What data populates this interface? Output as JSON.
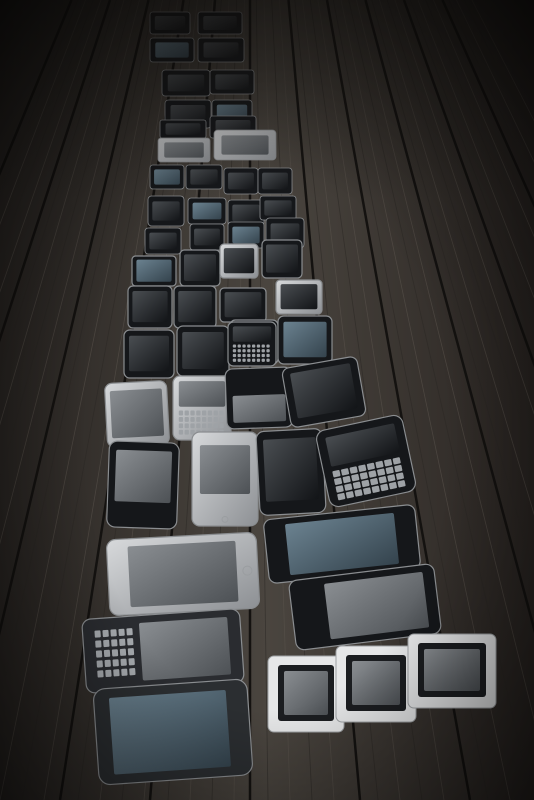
{
  "image": {
    "kind": "photograph",
    "palette": {
      "wood_dark": "#1c1916",
      "wood_mid": "#3e3a35",
      "wood_light": "#6b655c",
      "phone_body": "#15171a",
      "phone_silver": "#b9bcbf",
      "screen_grey": "#6f7377",
      "screen_blue": "#4f6574",
      "vignette": "#000000"
    },
    "phones": [
      {
        "model": "feature-phone",
        "count_visible": 2
      },
      {
        "model": "touchscreen-smartphone"
      },
      {
        "model": "qwerty-smartphone"
      },
      {
        "model": "slider-phone"
      },
      {
        "model": "square-mp3-player",
        "count_visible": 3
      }
    ]
  }
}
